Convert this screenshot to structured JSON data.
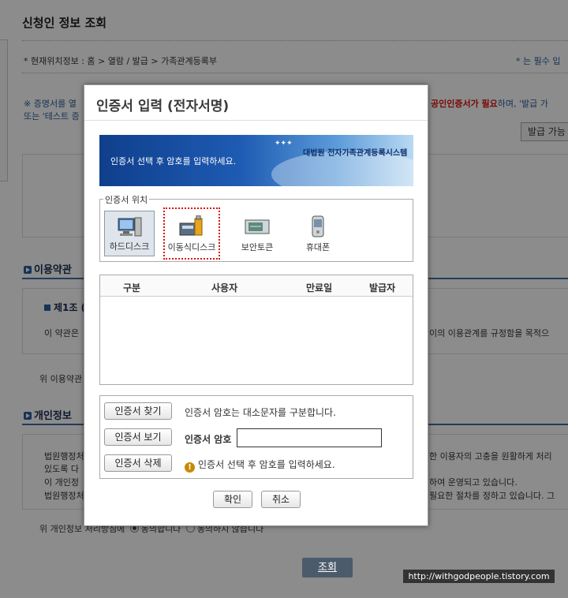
{
  "page": {
    "title": "신청인 정보 조회",
    "breadcrumb": "* 현재위치정보 : 홈 > 열람 / 발급 > 가족관계등록부",
    "required_note": "* 는 필수 입",
    "notice_line1_left": "※ 증명서를 열",
    "notice_line1_right_red": "공인인증서가 필요",
    "notice_line1_right_rest": "하며, '발급 가",
    "notice_line2_left": "또는 '테스트 증",
    "issue_button": "발급 가능",
    "terms_title": "이용약관",
    "article_title": "제1조 (",
    "article_text_left": "이 약관은",
    "article_text_right": "이의 이용관계를 규정함을 목적으",
    "terms_agree_left": "위 이용약관",
    "privacy_title": "개인정보",
    "privacy_line1_left": "법원행정처",
    "privacy_line1_right": "한 이용자의 고충을 원활하게 처리",
    "privacy_line2_left": "있도록 다",
    "privacy_line3_left": "이 개인정",
    "privacy_line3_right": "하여 운영되고 있습니다.",
    "privacy_line4_left": "법원행정처",
    "privacy_line4_right": "필요한 절차를 정하고 있습니다. 그",
    "privacy_agree": "위 개인정보 처리방침에",
    "privacy_agree_yes": "동의합니다",
    "privacy_agree_no": "동의하지 않습니다",
    "lookup_button": "조회",
    "watermark": "http://withgodpeople.tistory.com"
  },
  "dialog": {
    "title": "인증서 입력 (전자서명)",
    "banner_guide": "인증서 선택 후 암호를 입력하세요.",
    "banner_brand": "대법원 전자가족관계등록시스템",
    "location_legend": "인증서 위치",
    "devices": [
      {
        "label": "하드디스크",
        "icon": "hard-disk-icon"
      },
      {
        "label": "이동식디스크",
        "icon": "removable-disk-icon"
      },
      {
        "label": "보안토큰",
        "icon": "security-token-icon"
      },
      {
        "label": "휴대폰",
        "icon": "mobile-phone-icon"
      }
    ],
    "columns": [
      "구분",
      "사용자",
      "만료일",
      "발급자"
    ],
    "find_button": "인증서 찾기",
    "find_note": "인증서 암호는 대소문자를 구분합니다.",
    "view_button": "인증서 보기",
    "password_label": "인증서 암호",
    "password_value": "",
    "delete_button": "인증서 삭제",
    "delete_note": "인증서 선택 후 암호를 입력하세요.",
    "ok_button": "확인",
    "cancel_button": "취소"
  },
  "colors": {
    "accent_blue": "#2a5d9c",
    "highlight_red": "#d11111",
    "overlay": "rgba(0,0,0,0.45)"
  }
}
